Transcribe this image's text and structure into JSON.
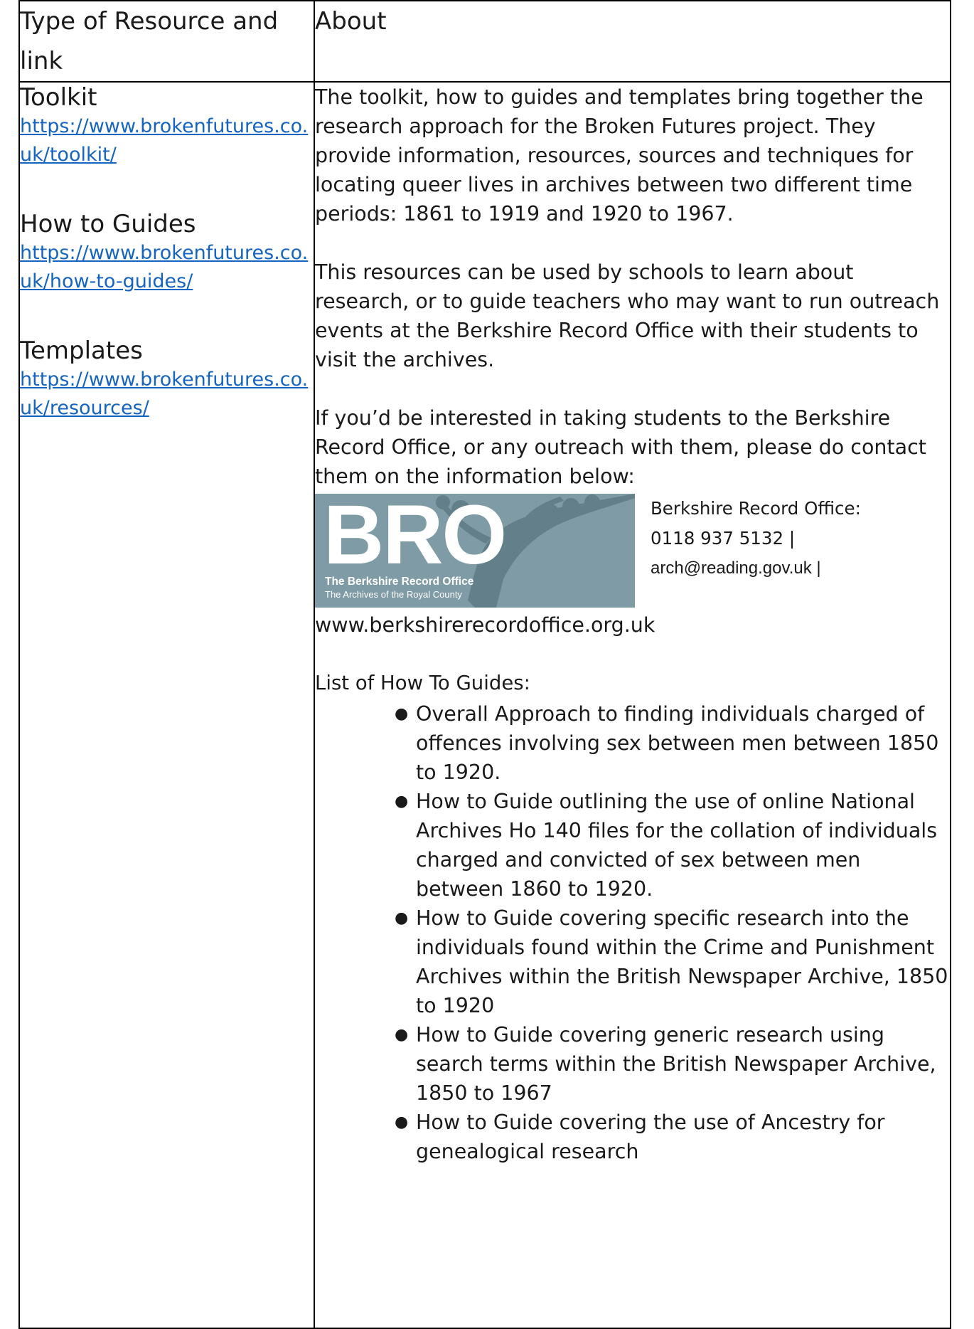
{
  "header": {
    "col1": "Type of Resource and link",
    "col2": "About"
  },
  "resources": [
    {
      "title": "Toolkit",
      "link": "https://www.brokenfutures.co.uk/toolkit/"
    },
    {
      "title": "How to Guides",
      "link": "https://www.brokenfutures.co.uk/how-to-guides/"
    },
    {
      "title": "Templates",
      "link": "https://www.brokenfutures.co.uk/resources/"
    }
  ],
  "about": {
    "para1": "The toolkit, how to guides and templates bring together the research approach for the Broken Futures project. They provide information, resources, sources and techniques for locating queer lives in archives between two different time periods: 1861 to 1919 and 1920 to 1967.",
    "para2": "This resources can be used by schools to learn about research, or to guide teachers who may want to run outreach events at the Berkshire Record Office with their students to visit the archives.",
    "para3": "If you’d be interested in taking students to the Berkshire Record Office, or any outreach with them, please do contact them on the information below:",
    "logo": {
      "letters": "BRO",
      "line1": "The Berkshire Record Office",
      "line2": "The Archives of the Royal County",
      "bg": "#7f9ca6"
    },
    "contact": {
      "name": "Berkshire Record Office:",
      "phone": "0118 937 5132 |",
      "email": "arch@reading.gov.uk |",
      "website": "www.berkshirerecordoffice.org.uk"
    },
    "guides_title": "List of How To Guides:",
    "guides": [
      "Overall Approach to finding individuals charged of offences involving sex between men between 1850 to 1920.",
      "How to Guide outlining the use of online National Archives Ho 140 files for the collation of individuals charged and convicted of sex between men between 1860 to 1920.",
      "How to Guide covering specific research into the individuals found within the Crime and Punishment Archives within the British Newspaper Archive, 1850 to 1920",
      "How to Guide covering generic research using search terms within the British Newspaper Archive, 1850 to 1967",
      "How to Guide covering the use of Ancestry for genealogical research"
    ]
  }
}
